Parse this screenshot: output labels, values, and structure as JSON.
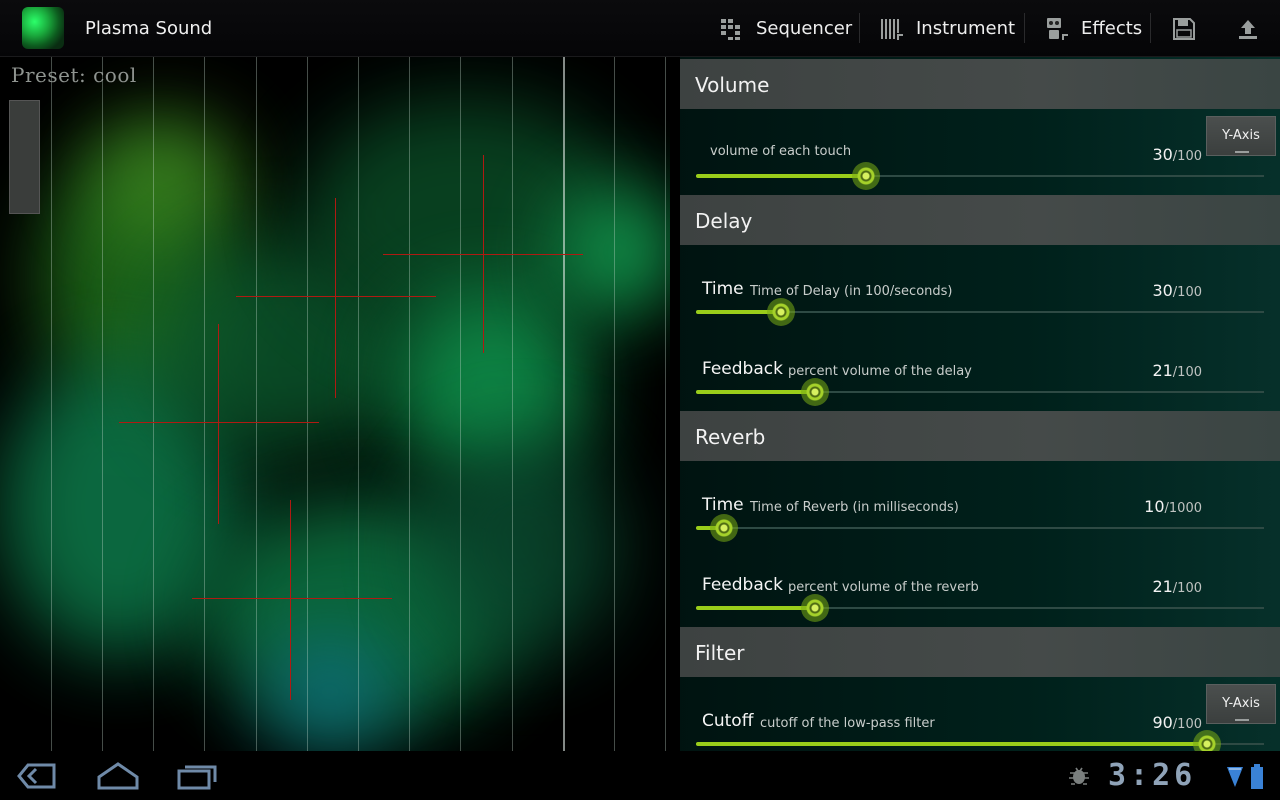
{
  "app": {
    "title": "Plasma Sound"
  },
  "action_bar": {
    "items": [
      {
        "label": "Sequencer",
        "icon": "sequencer-icon"
      },
      {
        "label": "Instrument",
        "icon": "instrument-icon"
      },
      {
        "label": "Effects",
        "icon": "effects-icon"
      }
    ],
    "icons": [
      "save-icon",
      "upload-icon"
    ]
  },
  "canvas": {
    "preset_label": "Preset: cool"
  },
  "sections": {
    "volume": {
      "header": "Volume",
      "row": {
        "label": "",
        "desc": "volume of each touch",
        "value": "30",
        "max": "/100",
        "fraction": 0.3,
        "y_axis": "Y-Axis"
      }
    },
    "delay": {
      "header": "Delay",
      "time": {
        "label": "Time",
        "desc": "Time of Delay (in 100/seconds)",
        "value": "30",
        "max": "/100",
        "fraction": 0.15
      },
      "feedback": {
        "label": "Feedback",
        "desc": "percent volume of the delay",
        "value": "21",
        "max": "/100",
        "fraction": 0.21
      }
    },
    "reverb": {
      "header": "Reverb",
      "time": {
        "label": "Time",
        "desc": "Time of Reverb (in milliseconds)",
        "value": "10",
        "max": "/1000",
        "fraction": 0.05
      },
      "feedback": {
        "label": "Feedback",
        "desc": "percent volume of the reverb",
        "value": "21",
        "max": "/100",
        "fraction": 0.21
      }
    },
    "filter": {
      "header": "Filter",
      "cutoff": {
        "label": "Cutoff",
        "desc": "cutoff of the low-pass filter",
        "value": "90",
        "max": "/100",
        "fraction": 0.9,
        "y_axis": "Y-Axis"
      }
    }
  },
  "system_bar": {
    "clock": "3:26"
  },
  "colors": {
    "accent": "#9acd1a",
    "touch": "#b01a12",
    "plasma": "#0f8a4a"
  }
}
